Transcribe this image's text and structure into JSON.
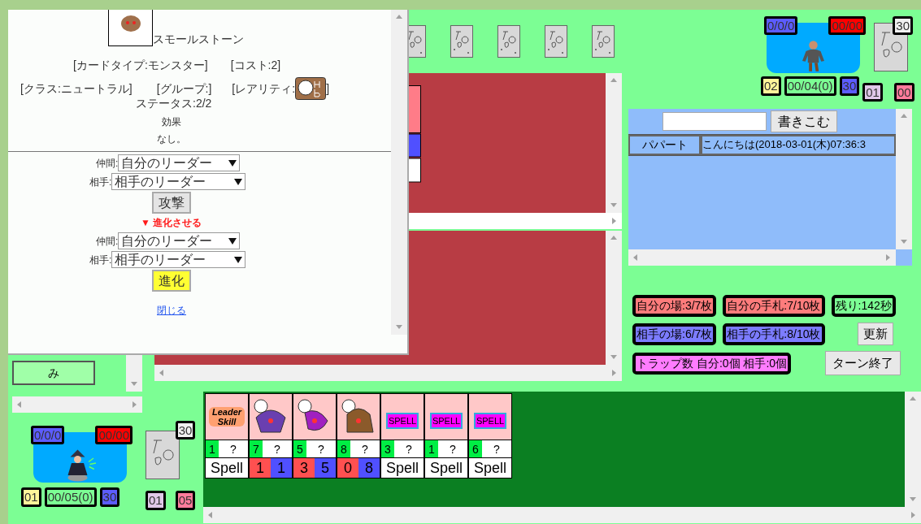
{
  "popup": {
    "card_name": "スモールストーン",
    "type_label": "[カードタイプ:モンスター]",
    "cost_label": "[コスト:2]",
    "class_label": "[クラス:ニュートラル]",
    "group_label": "[グループ:]",
    "rarity_open": "[レアリティ:",
    "rarity_close": "]",
    "status": "ステータス:2/2",
    "effect_heading": "効果",
    "effect": "なし。",
    "attack": {
      "ally_label": "仲間:",
      "ally_value": "自分のリーダー",
      "foe_label": "相手:",
      "foe_value": "相手のリーダー",
      "button": "攻撃"
    },
    "evolve_heading": "▼ 進化させる",
    "evolve": {
      "ally_label": "仲間:",
      "ally_value": "自分のリーダー",
      "foe_label": "相手:",
      "foe_value": "相手のリーダー",
      "button": "進化"
    },
    "close_link": "閉じる"
  },
  "left_panel": {
    "button": "み"
  },
  "opponent": {
    "hand_backs": [
      {
        "kind": "back"
      },
      {
        "kind": "back"
      },
      {
        "kind": "back"
      },
      {
        "kind": "back"
      },
      {
        "kind": "back"
      }
    ],
    "leader": {
      "stats": "0/0/0",
      "life": "00/00",
      "mana": "02",
      "counter": "00/04(0)",
      "badge": "30"
    },
    "deck_count": "30",
    "left_count": "01",
    "right_count": "00"
  },
  "chat": {
    "button": "書きこむ",
    "rows": [
      {
        "name": "パパート",
        "message": "こんにちは(2018-03-01(木)07:36:3"
      }
    ]
  },
  "status_badges": [
    {
      "text": "自分の場:3/7枚",
      "color": "#ff7c7c"
    },
    {
      "text": "自分の手札:7/10枚",
      "color": "#ff7c7c"
    },
    {
      "text": "残り:142秒",
      "color": "#7cfe94"
    },
    {
      "text": "相手の場:6/7枚",
      "color": "#7c7cff"
    },
    {
      "text": "相手の手札:8/10枚",
      "color": "#7c7cff"
    },
    {
      "text": "トラップ数 自分:0個 相手:0個",
      "color": "#ff7cff"
    }
  ],
  "buttons": {
    "refresh": "更新",
    "end_turn": "ターン終了"
  },
  "player": {
    "leader": {
      "stats": "0/0/0",
      "life": "00/00",
      "mana": "01",
      "counter": "00/05(0)",
      "badge": "30"
    },
    "deck_count": "30",
    "left_count": "01",
    "right_count": "05"
  },
  "hand": [
    {
      "kind": "leader",
      "art_label": "Leader Skill",
      "cost": "1",
      "unknown": "?",
      "spell_label": "Spell"
    },
    {
      "kind": "unit",
      "cost": "7",
      "unknown": "?",
      "attack": "1",
      "defense": "1"
    },
    {
      "kind": "unit",
      "cost": "5",
      "unknown": "?",
      "attack": "3",
      "defense": "5"
    },
    {
      "kind": "unit",
      "cost": "8",
      "unknown": "?",
      "attack": "0",
      "defense": "8"
    },
    {
      "kind": "spell",
      "art_label": "SPELL",
      "cost": "3",
      "unknown": "?",
      "spell_label": "Spell"
    },
    {
      "kind": "spell",
      "art_label": "SPELL",
      "cost": "1",
      "unknown": "?",
      "spell_label": "Spell"
    },
    {
      "kind": "spell",
      "art_label": "SPELL",
      "cost": "6",
      "unknown": "?",
      "spell_label": "Spell"
    }
  ]
}
